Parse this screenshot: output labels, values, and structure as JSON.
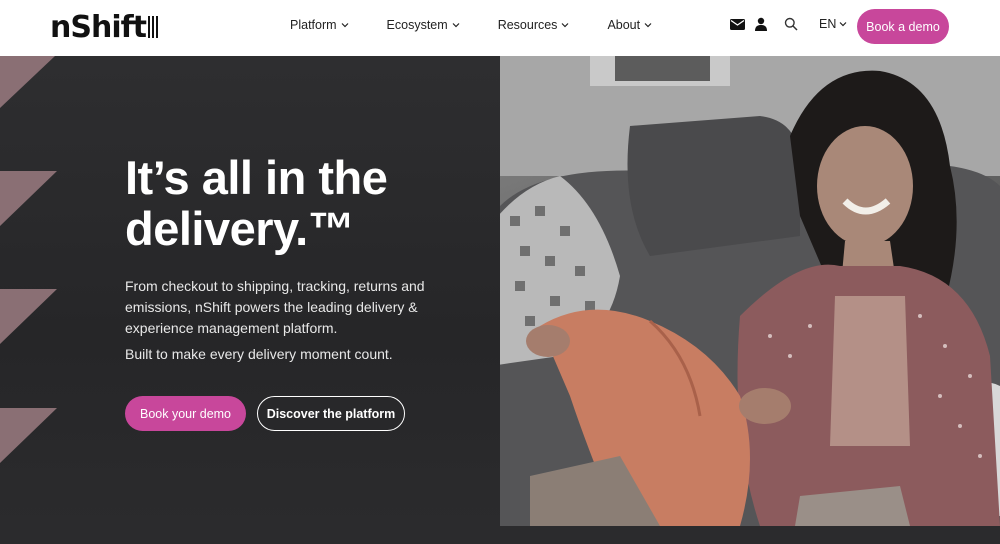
{
  "brand": {
    "logo_text": "nShift"
  },
  "nav": {
    "items": [
      {
        "label": "Platform"
      },
      {
        "label": "Ecosystem"
      },
      {
        "label": "Resources"
      },
      {
        "label": "About"
      }
    ]
  },
  "utilities": {
    "icons": [
      "mail-icon",
      "user-icon",
      "search-icon"
    ],
    "language": "EN"
  },
  "header_cta": {
    "label": "Book a demo"
  },
  "hero": {
    "title_line1": "It’s all in the",
    "title_line2": "delivery.™",
    "paragraph1": "From checkout to shipping, tracking, returns and emissions, nShift powers the leading delivery & experience management platform.",
    "paragraph2": "Built to make every delivery moment count.",
    "primary_button": "Book your demo",
    "secondary_button": "Discover the platform"
  },
  "colors": {
    "accent": "#c8479b",
    "hero_dark": "#2a2a2c",
    "triangle": "#8a6f74"
  }
}
